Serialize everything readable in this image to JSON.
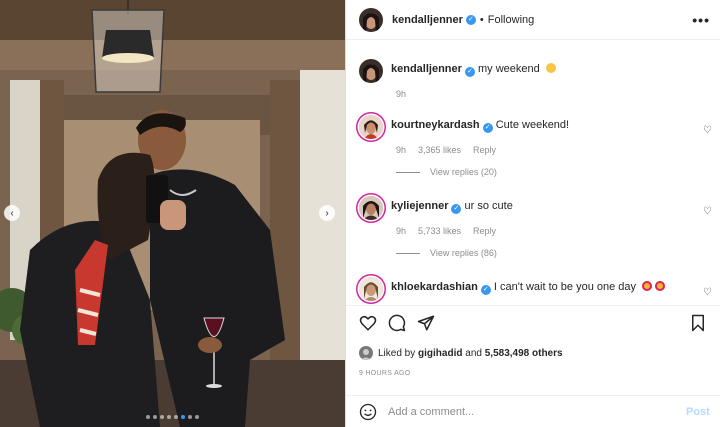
{
  "post": {
    "author": "kendalljenner",
    "follow_status": "Following",
    "separator": "•",
    "more": "•••",
    "caption": {
      "username": "kendalljenner",
      "text": "my weekend",
      "time": "9h"
    },
    "carousel": {
      "slides": 8,
      "active_index": 5,
      "prev": "‹",
      "next": "›"
    },
    "comments": [
      {
        "username": "kourtneykardash",
        "text": "Cute weekend!",
        "time": "9h",
        "likes": "3,365 likes",
        "reply": "Reply",
        "view_replies": "View replies (20)"
      },
      {
        "username": "kyliejenner",
        "text": "ur so cute",
        "time": "9h",
        "likes": "5,733 likes",
        "reply": "Reply",
        "view_replies": "View replies (86)"
      },
      {
        "username": "khloekardashian",
        "text": "I can't wait to be you one day"
      }
    ],
    "liked_by": {
      "prefix": "Liked by",
      "user": "gigihadid",
      "and": "and",
      "others": "5,583,498 others"
    },
    "time_ago": "9 HOURS AGO",
    "comment_input": {
      "placeholder": "Add a comment...",
      "post_label": "Post"
    }
  },
  "icons": {
    "verified": "✓",
    "comment_like": "♡"
  },
  "colors": {
    "accent": "#3897f0",
    "post_disabled": "#b3dbff",
    "story_ring": "#d6249f"
  }
}
